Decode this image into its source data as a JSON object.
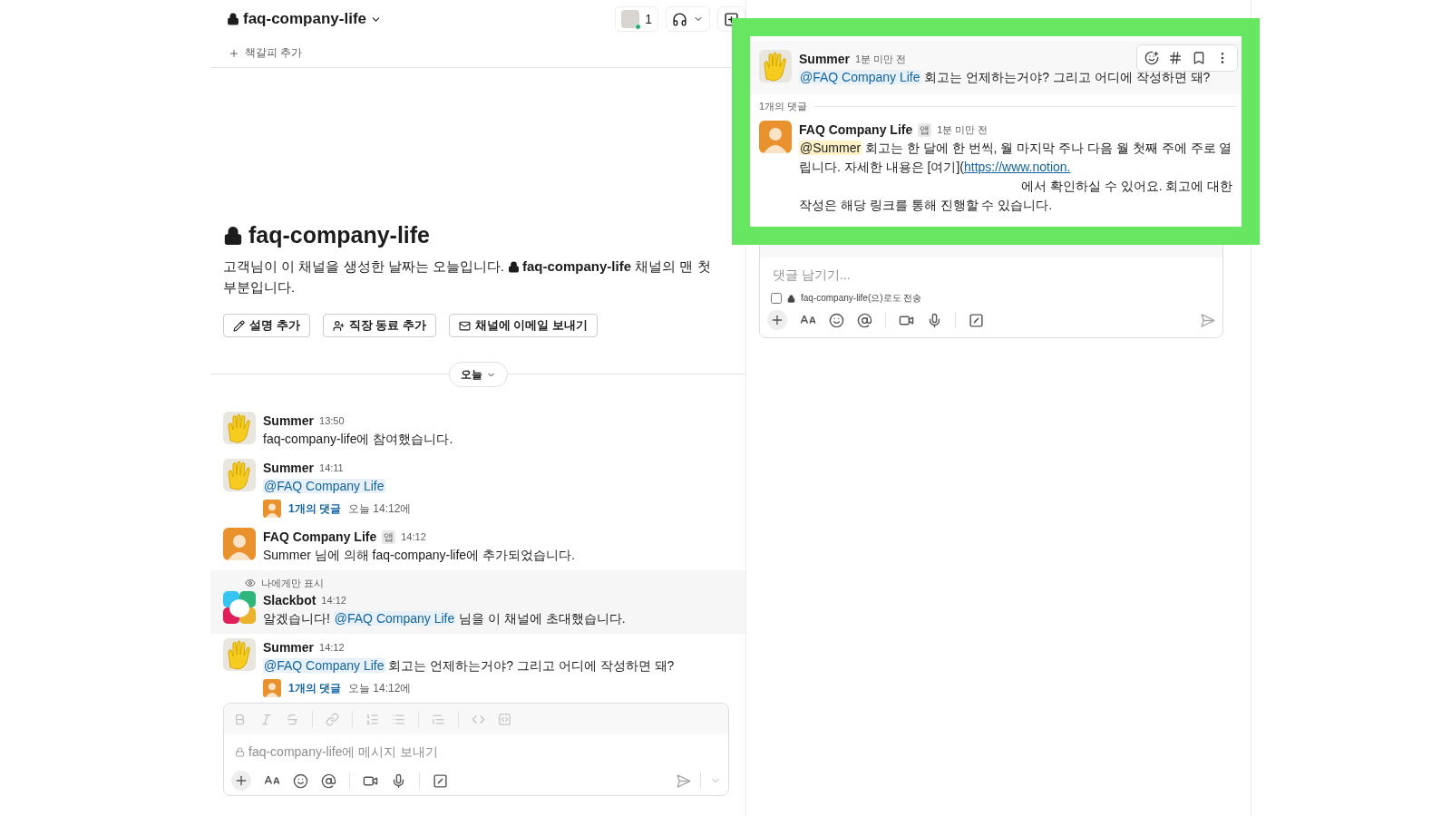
{
  "channel_header": {
    "name": "faq-company-life",
    "members_count": "1",
    "bookmark": "책갈피 추가"
  },
  "intro": {
    "title": "faq-company-life",
    "description": "고객님이 이 채널을 생성한 날짜는 오늘입니다.",
    "channel": "faq-company-life",
    "description_end": "채널의 맨 첫 부분입니다.",
    "buttons": [
      {
        "kind": "pencil",
        "label": "설명 추가"
      },
      {
        "kind": "person",
        "label": "직장 동료 추가"
      },
      {
        "kind": "mail",
        "label": "채널에 이메일 보내기"
      }
    ]
  },
  "date_divider": "오늘",
  "messages": [
    {
      "author": "Summer",
      "avatar": {
        "kind": "hand"
      },
      "time": "13:50",
      "body": [
        {
          "kind": "text",
          "text": "faq-company-life에 참여했습니다."
        }
      ]
    },
    {
      "author": "Summer",
      "avatar": {
        "kind": "hand"
      },
      "time": "14:11",
      "body": [
        {
          "kind": "mention",
          "text": "@FAQ Company Life"
        }
      ],
      "thread": {
        "count": "1개의 댓글",
        "last": "오늘 14:12에"
      }
    },
    {
      "author": "FAQ Company Life",
      "avatar": {
        "kind": "person"
      },
      "badge": "앱",
      "time": "14:12",
      "body": [
        {
          "kind": "text",
          "text": "Summer 님에 의해 faq-company-life에 추가되었습니다."
        }
      ]
    },
    {
      "author": "Slackbot",
      "avatar": {
        "kind": "bot"
      },
      "time": "14:12",
      "ephemeral_note": "나에게만 표시",
      "body": [
        {
          "kind": "text",
          "text": "알겠습니다! "
        },
        {
          "kind": "mention",
          "text": "@FAQ Company Life"
        },
        {
          "kind": "text",
          "text": " 님을 이 채널에 초대했습니다."
        }
      ]
    },
    {
      "author": "Summer",
      "avatar": {
        "kind": "hand"
      },
      "time": "14:12",
      "body": [
        {
          "kind": "mention",
          "text": "@FAQ Company Life"
        },
        {
          "kind": "text",
          "text": " 회고는 언제하는거야? 그리고 어디에 작성하면 돼?"
        }
      ],
      "thread": {
        "count": "1개의 댓글",
        "last": "오늘 14:12에"
      }
    }
  ],
  "composer": {
    "placeholder": "faq-company-life에 메시지 보내기"
  },
  "thread": {
    "root": {
      "author": "Summer",
      "avatar": {
        "kind": "hand"
      },
      "time": "1분 미만 전",
      "body": [
        {
          "kind": "mention",
          "text": "@FAQ Company Life"
        },
        {
          "kind": "text",
          "text": " 회고는 언제하는거야? 그리고 어디에 작성하면 돼?"
        }
      ]
    },
    "reply_count": "1개의 댓글",
    "replies": [
      {
        "author": "FAQ Company Life",
        "avatar": {
          "kind": "person"
        },
        "badge": "앱",
        "time": "1분 미만 전",
        "body": [
          {
            "kind": "self_mention",
            "text": "@Summer"
          },
          {
            "kind": "text",
            "text": " 회고는 한 달에 한 번씩, 월 마지막 주나 다음 월 첫째 주에 주로 열립니다. 자세한 내용은 [여기]("
          },
          {
            "kind": "link",
            "text": "https://www.notion."
          },
          {
            "kind": "redacted"
          },
          {
            "kind": "text",
            "text": "에서 확인하실 수 있어요. 회고에 대한 작성은 해당 링크를 통해 진행할 수 있습니다."
          }
        ]
      }
    ],
    "composer": {
      "placeholder": "댓글 남기기...",
      "also_send": "faq-company-life(으)로도 전송",
      "also_send_checked": false
    }
  },
  "annotation": {
    "kind": "frame"
  }
}
